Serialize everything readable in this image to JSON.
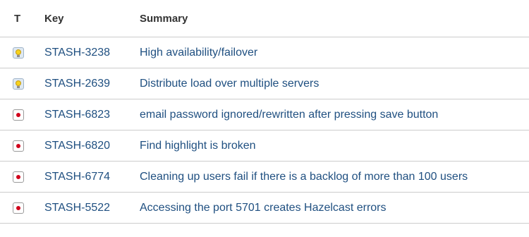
{
  "table": {
    "headers": {
      "type": "T",
      "key": "Key",
      "summary": "Summary"
    },
    "rows": [
      {
        "type_icon": "improvement-icon",
        "key": "STASH-3238",
        "summary": "High availability/failover"
      },
      {
        "type_icon": "improvement-icon",
        "key": "STASH-2639",
        "summary": "Distribute load over multiple servers"
      },
      {
        "type_icon": "bug-icon",
        "key": "STASH-6823",
        "summary": "email password ignored/rewritten after pressing save button"
      },
      {
        "type_icon": "bug-icon",
        "key": "STASH-6820",
        "summary": "Find highlight is broken"
      },
      {
        "type_icon": "bug-icon",
        "key": "STASH-6774",
        "summary": "Cleaning up users fail if there is a backlog of more than 100 users"
      },
      {
        "type_icon": "bug-icon",
        "key": "STASH-5522",
        "summary": "Accessing the port 5701 creates Hazelcast errors"
      }
    ]
  },
  "colors": {
    "link": "#205081",
    "divider": "#cccccc",
    "header_text": "#333333",
    "bug": "#d0021b"
  }
}
